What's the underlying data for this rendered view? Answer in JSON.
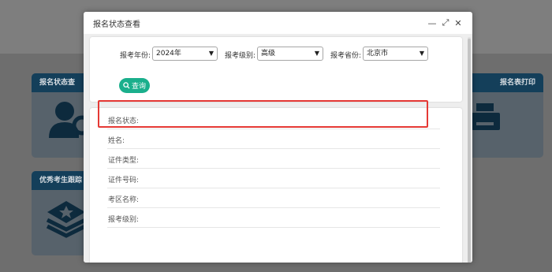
{
  "background": {
    "cards": [
      {
        "id": "status",
        "label": "报名状态查",
        "icon": "user-search-icon"
      },
      {
        "id": "print",
        "label": "报名表打印",
        "icon": "printer-icon"
      },
      {
        "id": "excellent",
        "label": "优秀考生跟踪",
        "icon": "layers-star-icon"
      }
    ]
  },
  "modal": {
    "title": "报名状态查看",
    "controls": {
      "minimize": "—",
      "maximize": "⤢",
      "close": "✕"
    },
    "search": {
      "year_label": "报考年份:",
      "year_value": "2024年",
      "level_label": "报考级别:",
      "level_value": "高级",
      "province_label": "报考省份:",
      "province_value": "北京市",
      "query_button": "查询"
    },
    "result": {
      "fields": [
        "报名状态:",
        "姓名:",
        "证件类型:",
        "证件号码:",
        "考区名称:",
        "报考级别:"
      ]
    }
  }
}
